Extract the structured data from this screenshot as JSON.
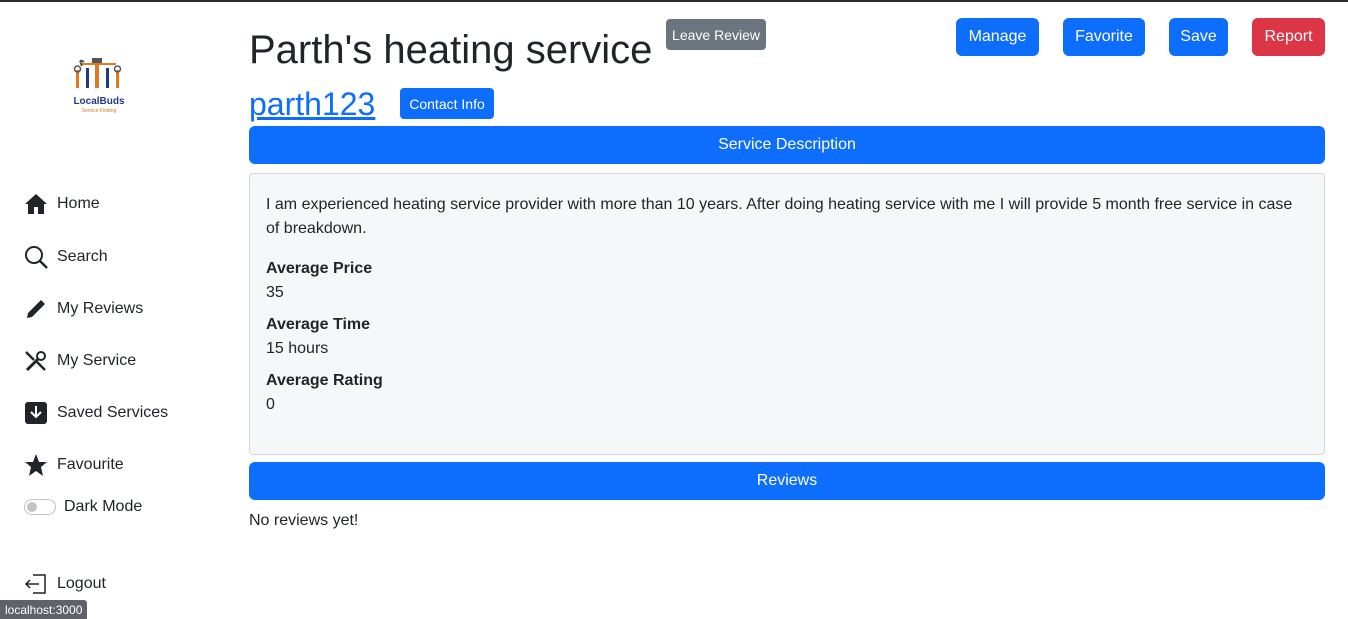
{
  "sidebar": {
    "logo": {
      "brand": "LocalBuds",
      "tagline": "Service Finding"
    },
    "items": [
      {
        "label": "Home",
        "icon": "home-icon"
      },
      {
        "label": "Search",
        "icon": "search-icon"
      },
      {
        "label": "My Reviews",
        "icon": "pencil-icon"
      },
      {
        "label": "My Service",
        "icon": "tools-icon"
      },
      {
        "label": "Saved Services",
        "icon": "download-icon"
      },
      {
        "label": "Favourite",
        "icon": "star-icon"
      }
    ],
    "dark_mode_label": "Dark Mode",
    "logout_label": "Logout"
  },
  "header": {
    "title": "Parth's heating service",
    "leave_review": "Leave Review",
    "manage": "Manage",
    "favorite": "Favorite",
    "save": "Save",
    "report": "Report",
    "username": "parth123",
    "contact_info": "Contact Info"
  },
  "description": {
    "heading": "Service Description",
    "text": "I am experienced heating service provider with more than 10 years. After doing heating service with me I will provide 5 month free service in case of breakdown.",
    "avg_price_label": "Average Price",
    "avg_price": "35",
    "avg_time_label": "Average Time",
    "avg_time": "15 hours",
    "avg_rating_label": "Average Rating",
    "avg_rating": "0"
  },
  "reviews": {
    "heading": "Reviews",
    "empty_text": "No reviews yet!"
  },
  "status_bar": {
    "url": "localhost:3000"
  },
  "colors": {
    "primary": "#0d6efd",
    "danger": "#dc3545",
    "secondary": "#6c757d"
  }
}
